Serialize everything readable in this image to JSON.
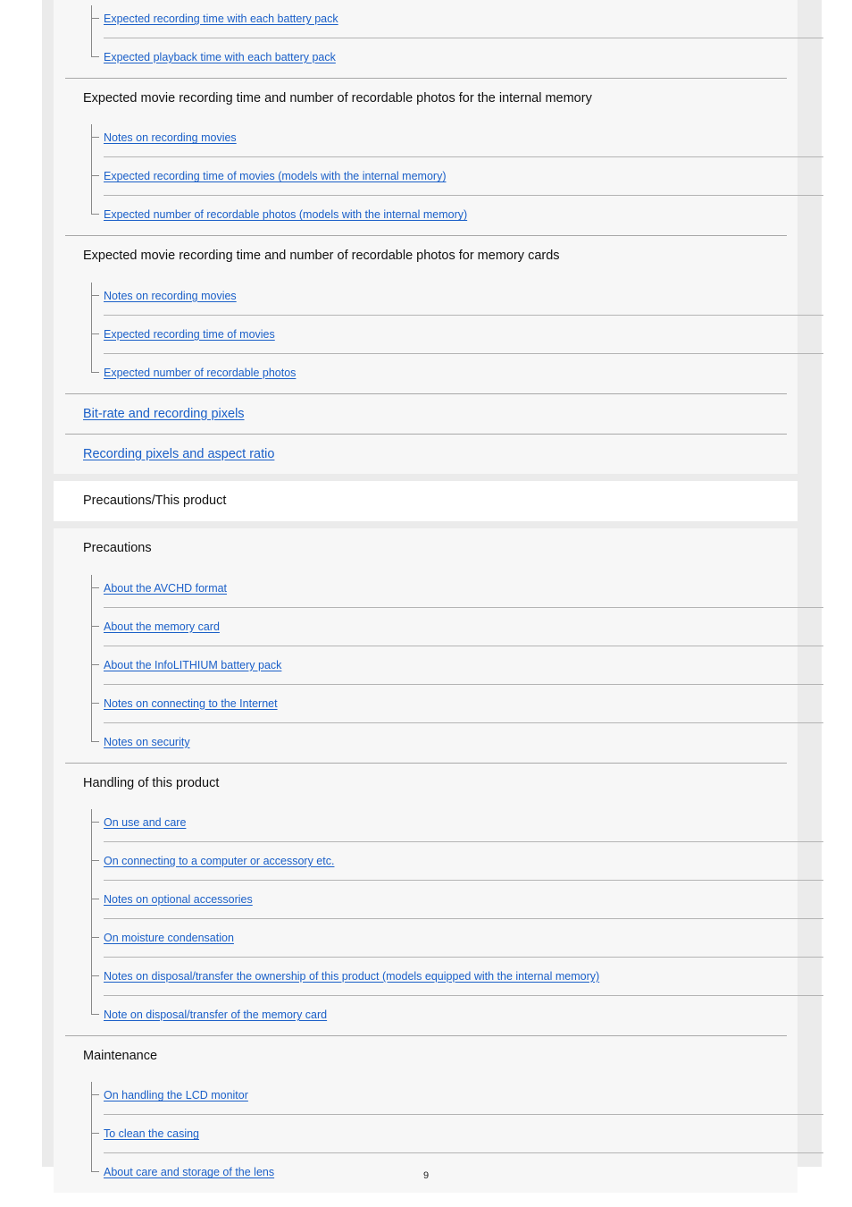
{
  "page": {
    "number": "9",
    "link_color": "#1a5fc8",
    "content_bg": "#f7f7f7",
    "gutter_bg": "#ebebeb",
    "section_bg": "#ffffff"
  },
  "blocks": [
    {
      "kind": "tree-only",
      "items": [
        "Expected recording time with each battery pack",
        "Expected playback time with each battery pack"
      ]
    },
    {
      "kind": "heading-tree",
      "heading": "Expected movie recording time and number of recordable photos for the internal memory",
      "items": [
        "Notes on recording movies",
        "Expected recording time of movies (models with the internal memory)",
        "Expected number of recordable photos (models with the internal memory)"
      ]
    },
    {
      "kind": "heading-tree",
      "heading": "Expected movie recording time and number of recordable photos for memory cards",
      "items": [
        "Notes on recording movies",
        "Expected recording time of movies",
        "Expected number of recordable photos"
      ]
    },
    {
      "kind": "toplink",
      "label": "Bit-rate and recording pixels"
    },
    {
      "kind": "toplink",
      "label": "Recording pixels and aspect ratio"
    },
    {
      "kind": "section",
      "label": "Precautions/This product"
    },
    {
      "kind": "heading-tree",
      "heading": "Precautions",
      "items": [
        "About the AVCHD format",
        "About the memory card",
        "About the InfoLITHIUM battery pack",
        "Notes on connecting to the Internet",
        "Notes on security"
      ]
    },
    {
      "kind": "heading-tree",
      "heading": "Handling of this product",
      "items": [
        "On use and care",
        "On connecting to a computer or accessory etc.",
        "Notes on optional accessories",
        "On moisture condensation",
        "Notes on disposal/transfer the ownership of this product (models equipped with the internal memory)",
        "Note on disposal/transfer of the memory card"
      ]
    },
    {
      "kind": "heading-tree",
      "heading": "Maintenance",
      "items": [
        "On handling the LCD monitor",
        "To clean the casing",
        "About care and storage of the lens"
      ]
    }
  ]
}
